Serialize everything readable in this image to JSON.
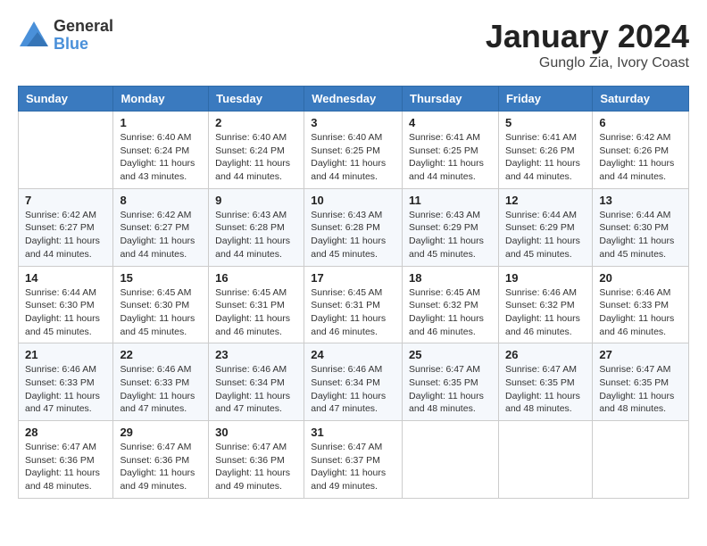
{
  "header": {
    "logo_general": "General",
    "logo_blue": "Blue",
    "month_title": "January 2024",
    "location": "Gunglo Zia, Ivory Coast"
  },
  "days_of_week": [
    "Sunday",
    "Monday",
    "Tuesday",
    "Wednesday",
    "Thursday",
    "Friday",
    "Saturday"
  ],
  "weeks": [
    [
      {
        "day": "",
        "info": ""
      },
      {
        "day": "1",
        "info": "Sunrise: 6:40 AM\nSunset: 6:24 PM\nDaylight: 11 hours\nand 43 minutes."
      },
      {
        "day": "2",
        "info": "Sunrise: 6:40 AM\nSunset: 6:24 PM\nDaylight: 11 hours\nand 44 minutes."
      },
      {
        "day": "3",
        "info": "Sunrise: 6:40 AM\nSunset: 6:25 PM\nDaylight: 11 hours\nand 44 minutes."
      },
      {
        "day": "4",
        "info": "Sunrise: 6:41 AM\nSunset: 6:25 PM\nDaylight: 11 hours\nand 44 minutes."
      },
      {
        "day": "5",
        "info": "Sunrise: 6:41 AM\nSunset: 6:26 PM\nDaylight: 11 hours\nand 44 minutes."
      },
      {
        "day": "6",
        "info": "Sunrise: 6:42 AM\nSunset: 6:26 PM\nDaylight: 11 hours\nand 44 minutes."
      }
    ],
    [
      {
        "day": "7",
        "info": "Sunrise: 6:42 AM\nSunset: 6:27 PM\nDaylight: 11 hours\nand 44 minutes."
      },
      {
        "day": "8",
        "info": "Sunrise: 6:42 AM\nSunset: 6:27 PM\nDaylight: 11 hours\nand 44 minutes."
      },
      {
        "day": "9",
        "info": "Sunrise: 6:43 AM\nSunset: 6:28 PM\nDaylight: 11 hours\nand 44 minutes."
      },
      {
        "day": "10",
        "info": "Sunrise: 6:43 AM\nSunset: 6:28 PM\nDaylight: 11 hours\nand 45 minutes."
      },
      {
        "day": "11",
        "info": "Sunrise: 6:43 AM\nSunset: 6:29 PM\nDaylight: 11 hours\nand 45 minutes."
      },
      {
        "day": "12",
        "info": "Sunrise: 6:44 AM\nSunset: 6:29 PM\nDaylight: 11 hours\nand 45 minutes."
      },
      {
        "day": "13",
        "info": "Sunrise: 6:44 AM\nSunset: 6:30 PM\nDaylight: 11 hours\nand 45 minutes."
      }
    ],
    [
      {
        "day": "14",
        "info": "Sunrise: 6:44 AM\nSunset: 6:30 PM\nDaylight: 11 hours\nand 45 minutes."
      },
      {
        "day": "15",
        "info": "Sunrise: 6:45 AM\nSunset: 6:30 PM\nDaylight: 11 hours\nand 45 minutes."
      },
      {
        "day": "16",
        "info": "Sunrise: 6:45 AM\nSunset: 6:31 PM\nDaylight: 11 hours\nand 46 minutes."
      },
      {
        "day": "17",
        "info": "Sunrise: 6:45 AM\nSunset: 6:31 PM\nDaylight: 11 hours\nand 46 minutes."
      },
      {
        "day": "18",
        "info": "Sunrise: 6:45 AM\nSunset: 6:32 PM\nDaylight: 11 hours\nand 46 minutes."
      },
      {
        "day": "19",
        "info": "Sunrise: 6:46 AM\nSunset: 6:32 PM\nDaylight: 11 hours\nand 46 minutes."
      },
      {
        "day": "20",
        "info": "Sunrise: 6:46 AM\nSunset: 6:33 PM\nDaylight: 11 hours\nand 46 minutes."
      }
    ],
    [
      {
        "day": "21",
        "info": "Sunrise: 6:46 AM\nSunset: 6:33 PM\nDaylight: 11 hours\nand 47 minutes."
      },
      {
        "day": "22",
        "info": "Sunrise: 6:46 AM\nSunset: 6:33 PM\nDaylight: 11 hours\nand 47 minutes."
      },
      {
        "day": "23",
        "info": "Sunrise: 6:46 AM\nSunset: 6:34 PM\nDaylight: 11 hours\nand 47 minutes."
      },
      {
        "day": "24",
        "info": "Sunrise: 6:46 AM\nSunset: 6:34 PM\nDaylight: 11 hours\nand 47 minutes."
      },
      {
        "day": "25",
        "info": "Sunrise: 6:47 AM\nSunset: 6:35 PM\nDaylight: 11 hours\nand 48 minutes."
      },
      {
        "day": "26",
        "info": "Sunrise: 6:47 AM\nSunset: 6:35 PM\nDaylight: 11 hours\nand 48 minutes."
      },
      {
        "day": "27",
        "info": "Sunrise: 6:47 AM\nSunset: 6:35 PM\nDaylight: 11 hours\nand 48 minutes."
      }
    ],
    [
      {
        "day": "28",
        "info": "Sunrise: 6:47 AM\nSunset: 6:36 PM\nDaylight: 11 hours\nand 48 minutes."
      },
      {
        "day": "29",
        "info": "Sunrise: 6:47 AM\nSunset: 6:36 PM\nDaylight: 11 hours\nand 49 minutes."
      },
      {
        "day": "30",
        "info": "Sunrise: 6:47 AM\nSunset: 6:36 PM\nDaylight: 11 hours\nand 49 minutes."
      },
      {
        "day": "31",
        "info": "Sunrise: 6:47 AM\nSunset: 6:37 PM\nDaylight: 11 hours\nand 49 minutes."
      },
      {
        "day": "",
        "info": ""
      },
      {
        "day": "",
        "info": ""
      },
      {
        "day": "",
        "info": ""
      }
    ]
  ]
}
